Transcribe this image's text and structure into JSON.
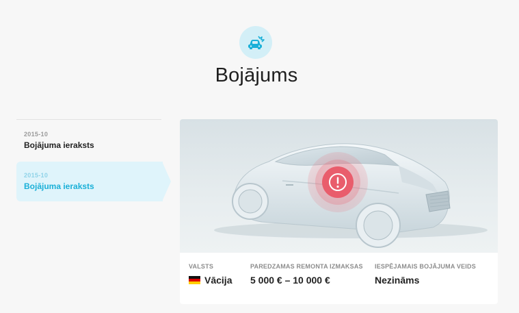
{
  "header": {
    "icon": "car-damage-icon",
    "title": "Bojājums",
    "accent_color": "#1ab0d8"
  },
  "sidebar": {
    "items": [
      {
        "date": "2015-10",
        "label": "Bojājuma ieraksts",
        "active": false
      },
      {
        "date": "2015-10",
        "label": "Bojājuma ieraksts",
        "active": true
      }
    ]
  },
  "details": {
    "image_icon": "warning-marker-icon",
    "country": {
      "caption": "VALSTS",
      "value": "Vācija",
      "flag_icon": "germany-flag-icon"
    },
    "repair_cost": {
      "caption": "PAREDZAMAS REMONTA IZMAKSAS",
      "value": "5 000 € – 10 000 €"
    },
    "damage_type": {
      "caption": "IESPĒJAMAIS BOJĀJUMA VEIDS",
      "value": "Nezināms"
    }
  }
}
